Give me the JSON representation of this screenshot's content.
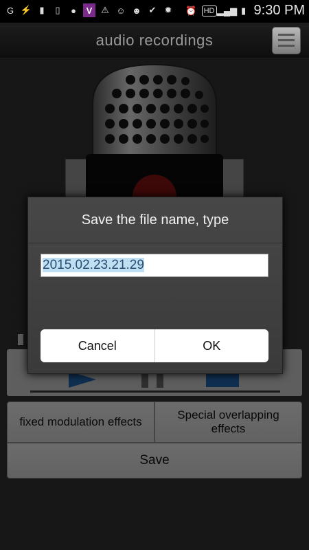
{
  "status_bar": {
    "left_icons": [
      "carrier-icon",
      "usb-icon",
      "sim-icon",
      "storage-icon",
      "talk-icon",
      "v-icon",
      "warning-icon",
      "game-icon",
      "game2-icon",
      "check-icon",
      "android-icon"
    ],
    "time": "9:30 PM",
    "hd_label": "HD"
  },
  "header": {
    "title": "audio recordings"
  },
  "player": {
    "accent": "#1e5ea3"
  },
  "effects": {
    "fixed_label": "fixed modulation effects",
    "overlap_label": "Special overlapping effects",
    "save_label": "Save"
  },
  "dialog": {
    "title": "Save the file name, type",
    "filename_value": "2015.02.23.21.29",
    "cancel_label": "Cancel",
    "ok_label": "OK"
  }
}
